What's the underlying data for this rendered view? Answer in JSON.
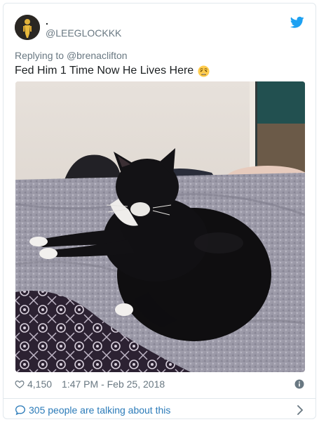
{
  "tweet": {
    "display_name": ".",
    "handle": "@LEEGLOCKKK",
    "reply_prefix": "Replying to",
    "reply_to": "@brenaclifton",
    "text": "Fed Him 1 Time Now He Lives Here",
    "emoji_icon": "weary-face-emoji",
    "media_icon": "photo-of-black-and-white-cat-on-bed",
    "likes": "4,150",
    "timestamp": "1:47 PM - Feb 25, 2018",
    "talking": "305 people are talking about this"
  },
  "colors": {
    "accent": "#1da1f2",
    "link": "#2b7bb9",
    "muted": "#697882",
    "border": "#e1e8ed"
  }
}
